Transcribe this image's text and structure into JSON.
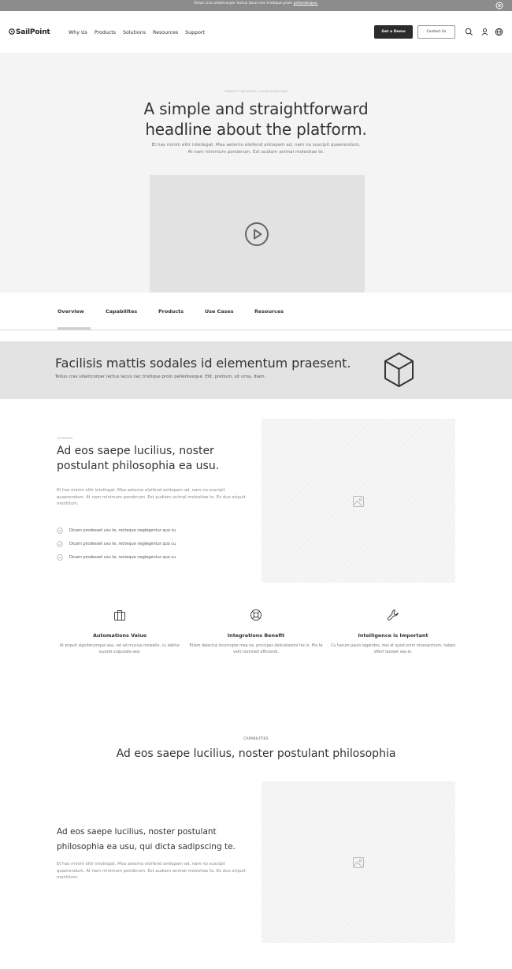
{
  "announcement": {
    "text": "Tellus cras ullamcorper lectus lacus nec tristique proin ",
    "link": "pellentesque."
  },
  "nav": {
    "logo": "SailPoint",
    "links": [
      "Why Us",
      "Products",
      "Solutions",
      "Resources",
      "Support"
    ],
    "demo_label": "Get a Demo",
    "contact_label": "Contact Us",
    "icons": [
      "search-icon",
      "user-icon",
      "globe-icon"
    ]
  },
  "hero": {
    "eyebrow": "IDENTITY SECURITY CLOUD PLATFORM",
    "title_line1": "A simple and straightforward",
    "title_line2": "headline about the platform.",
    "subtitle_line1": "Et has minim elitr intellegat. Mea aeterno eleifend antiopam ad, nam no suscipit quaerendum.",
    "subtitle_line2": "At nam minimum ponderum. Est audiam animal molestiae te."
  },
  "tabs": [
    "Overview",
    "Capabilites",
    "Products",
    "Use Cases",
    "Resources"
  ],
  "banner": {
    "title": "Facilisis mattis sodales id elementum praesent.",
    "subtitle": "Tellus cras ullamcorper lectus lacus nec tristique proin pellentesque. Elit, pretium, sit urna, diam."
  },
  "overview": {
    "eyebrow": "OVERVIEW",
    "title": "Ad eos saepe lucilius, noster postulant philosophia ea usu.",
    "body": "Et has minim elitr intellegat. Mea aeterno eleifend antiopam ad, nam no suscipit quaerendum. At nam minimum ponderum. Est audiam animal molestiae te. Ex duo eripuit mentitum.",
    "checks": [
      "Dicam prodesset usu te, recteque neglegentur quo cu",
      "Dicam prodesset usu te, recteque neglegentur quo cu",
      "Dicam prodesset usu te, recteque neglegentur quo cu"
    ]
  },
  "features": [
    {
      "icon": "briefcase-icon",
      "title": "Automations Value",
      "desc": "At eripuit signiferumque sea, vel ad mucius molestie, cu labitur iuvaret vulputate sed."
    },
    {
      "icon": "lifebuoy-icon",
      "title": "Integrations Benefit",
      "desc": "Etiam delectus incorrupte mea ne, principes delicatissimi his in. His te velit nominati efficiendi."
    },
    {
      "icon": "wrench-icon",
      "title": "Intelligence is Important",
      "desc": "Cu harum paulo legendos, mei et quod enim mnesarchum, habeo offert laoreet sea ei."
    }
  ],
  "capabilities": {
    "eyebrow": "CAPABILITIES",
    "title": "Ad eos saepe lucilius, noster postulant philosophia",
    "item_title": "Ad eos saepe lucilius, noster postulant philosophia ea usu, qui dicta sadipscing te.",
    "item_body": "Et has minim elitr intellegat. Mea aeterno eleifend antiopam ad, nam no suscipit quaerendum. At nam minimum ponderum. Est audiam animal molestiae te. Ex duo eripuit mentitum."
  }
}
